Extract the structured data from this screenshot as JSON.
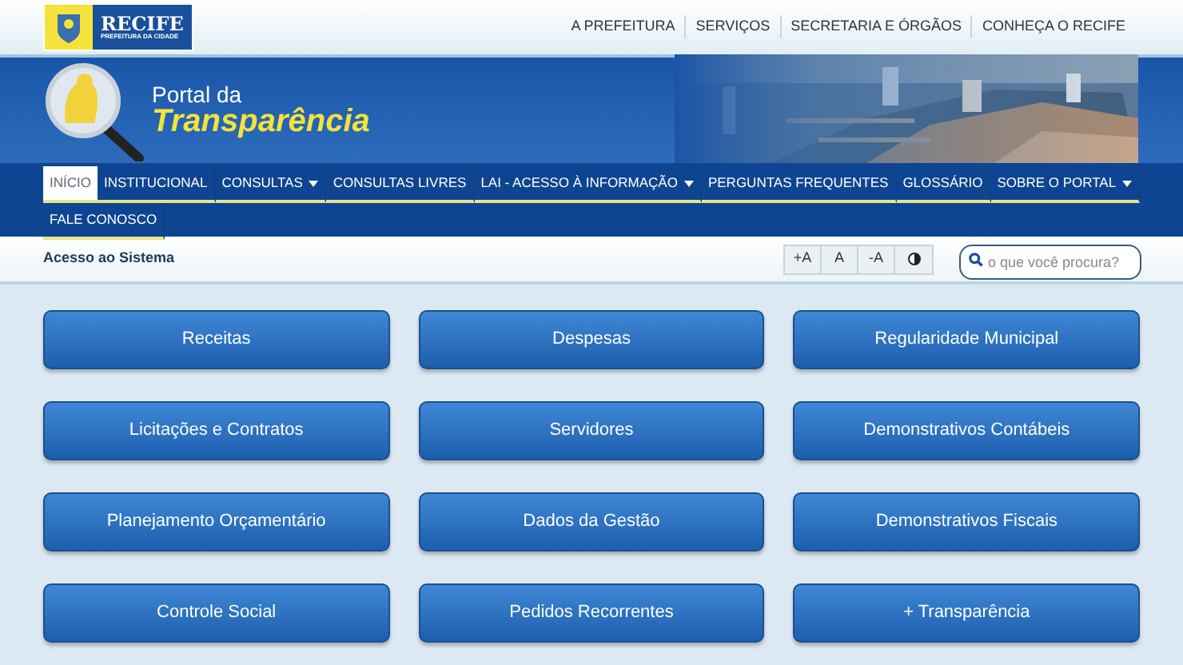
{
  "top_bar": {
    "logo": {
      "name": "RECIFE",
      "subtitle": "PREFEITURA DA CIDADE"
    },
    "links": [
      "A PREFEITURA",
      "SERVIÇOS",
      "SECRETARIA E ÓRGÃOS",
      "CONHEÇA O RECIFE"
    ]
  },
  "header": {
    "title_small": "Portal da",
    "title_large": "Transparência"
  },
  "nav": [
    {
      "label": "INÍCIO",
      "selected": true,
      "dropdown": false
    },
    {
      "label": "INSTITUCIONAL",
      "selected": false,
      "dropdown": false
    },
    {
      "label": "CONSULTAS",
      "selected": false,
      "dropdown": true
    },
    {
      "label": "CONSULTAS LIVRES",
      "selected": false,
      "dropdown": false
    },
    {
      "label": "LAI - ACESSO À INFORMAÇÃO",
      "selected": false,
      "dropdown": true
    },
    {
      "label": "PERGUNTAS FREQUENTES",
      "selected": false,
      "dropdown": false
    },
    {
      "label": "GLOSSÁRIO",
      "selected": false,
      "dropdown": false
    },
    {
      "label": "SOBRE O PORTAL",
      "selected": false,
      "dropdown": true
    },
    {
      "label": "FALE CONOSCO",
      "selected": false,
      "dropdown": false
    }
  ],
  "sub_bar": {
    "login_link": "Acesso ao Sistema",
    "font_buttons": [
      "+A",
      "A",
      "-A"
    ],
    "search": {
      "placeholder": "o que você procura?"
    }
  },
  "tiles": [
    "Receitas",
    "Despesas",
    "Regularidade Municipal",
    "Licitações e Contratos",
    "Servidores",
    "Demonstrativos Contábeis",
    "Planejamento Orçamentário",
    "Dados da Gestão",
    "Demonstrativos Fiscais",
    "Controle Social",
    "Pedidos Recorrentes",
    "+ Transparência"
  ]
}
